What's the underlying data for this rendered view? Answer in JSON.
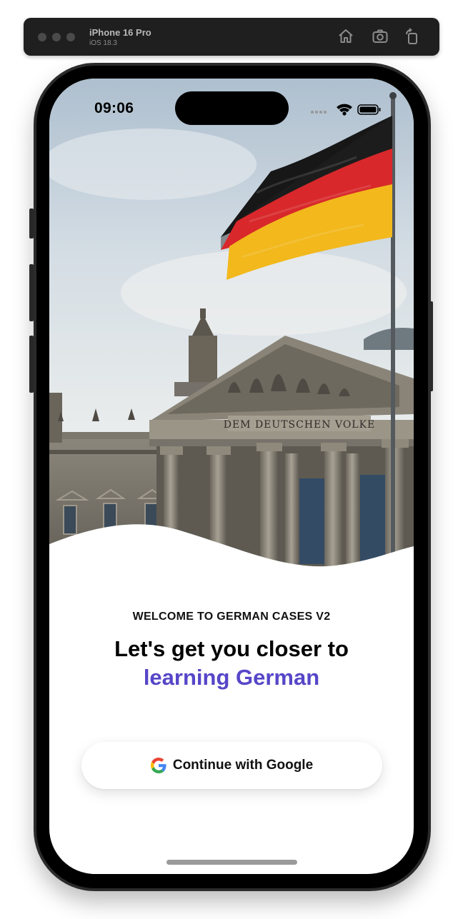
{
  "simulator": {
    "device_name": "iPhone 16 Pro",
    "os_version": "iOS 18.3",
    "icons": [
      "home-icon",
      "screenshot-icon",
      "rotate-icon"
    ]
  },
  "status_bar": {
    "time": "09:06",
    "icons": [
      "cellular-icon",
      "wifi-icon",
      "battery-icon"
    ]
  },
  "hero": {
    "subject": "Reichstag building with German flag",
    "inscription": "DEM DEUTSCHEN VOLKE"
  },
  "welcome": {
    "eyebrow": "WELCOME TO GERMAN CASES V2",
    "headline": "Let's get you closer to",
    "headline_accent": "learning German"
  },
  "auth": {
    "google_button_label": "Continue with Google"
  },
  "colors": {
    "accent": "#5646c8",
    "flag_black": "#1c1c1c",
    "flag_red": "#d8282b",
    "flag_gold": "#f2b81c"
  }
}
